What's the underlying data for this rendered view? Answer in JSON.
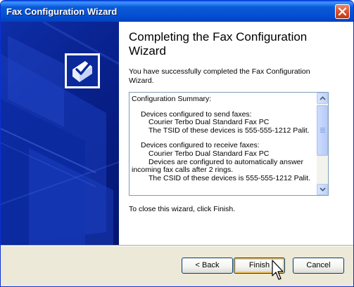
{
  "window": {
    "title": "Fax Configuration Wizard"
  },
  "icons": {
    "title_close": "close-icon",
    "logo": "wizard-checkmark-icon",
    "scroll_up": "chevron-up-icon",
    "scroll_down": "chevron-down-icon",
    "cursor": "mouse-pointer-icon"
  },
  "colors": {
    "titlebar": "#0450d2",
    "panel_blue": "#08208a",
    "focus_border": "#f9c563"
  },
  "content": {
    "heading": "Completing the Fax Configuration Wizard",
    "intro": "You have successfully completed the Fax Configuration Wizard.",
    "summary": {
      "title": "Configuration Summary:",
      "send_header": "Devices configured to send faxes:",
      "send_device": "Courier Terbo Dual Standard Fax PC",
      "send_tsid": "The TSID of these devices is 555-555-1212 Palit.",
      "receive_header": "Devices configured to receive faxes:",
      "receive_device": "Courier Terbo Dual Standard Fax PC",
      "receive_auto": "Devices are configured to automatically answer incoming fax calls after 2 rings.",
      "receive_csid": "The CSID of these devices is 555-555-1212 Palit."
    },
    "close_instruction": "To close this wizard, click Finish."
  },
  "buttons": {
    "back": "< Back",
    "finish": "Finish",
    "cancel": "Cancel"
  }
}
